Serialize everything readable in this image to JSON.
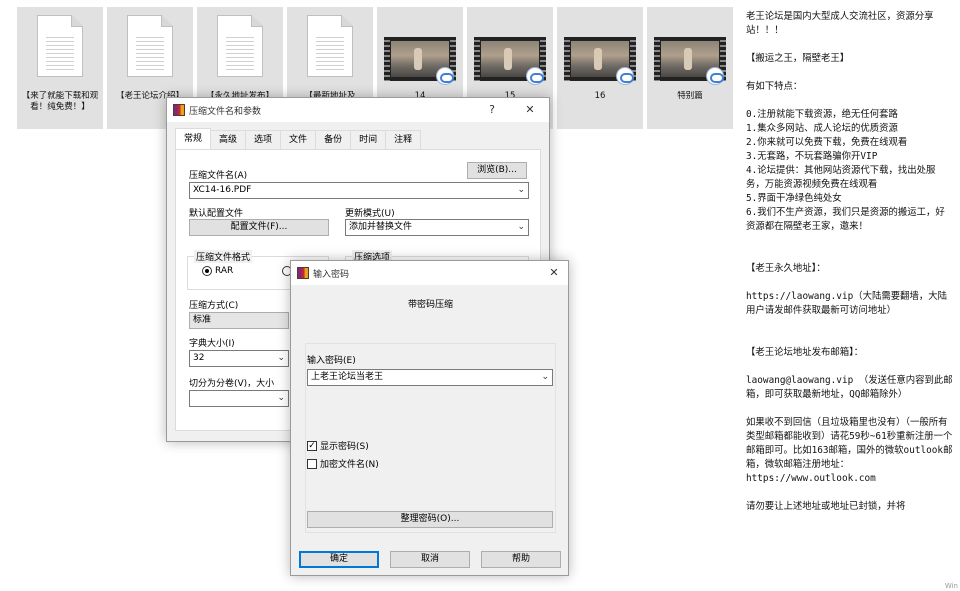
{
  "files": [
    {
      "name": "【来了就能下载和观看！纯免费！】",
      "kind": "document"
    },
    {
      "name": "【老王论坛介绍】",
      "kind": "document"
    },
    {
      "name": "【永久地址发布】",
      "kind": "document"
    },
    {
      "name": "【最新地址及",
      "kind": "document"
    },
    {
      "name": "14",
      "kind": "video"
    },
    {
      "name": "15",
      "kind": "video"
    },
    {
      "name": "16",
      "kind": "video"
    },
    {
      "name": "特别篇",
      "kind": "video"
    }
  ],
  "text_pane": {
    "lines": [
      "老王论坛是国内大型成人交流社区，资源分享站！！！",
      "",
      "【搬运之王，隔壁老王】",
      "",
      "有如下特点：",
      "",
      "0.注册就能下载资源，绝无任何套路\n1.集众多网站、成人论坛的优质资源\n2.你来就可以免费下载，免费在线观看\n3.无套路，不玩套路骗你开VIP\n4.论坛提供：其他网站资源代下载，找出处服务，万能资源视频免费在线观看\n5.界面干净绿色纯处女\n6.我们不生产资源，我们只是资源的搬运工，好资源都在隔壁老王家，邀来！",
      "",
      "",
      "【老王永久地址】：",
      "",
      "https://laowang.vip（大陆需要翻墙，大陆用户请发邮件获取最新可访问地址）",
      "",
      "",
      "【老王论坛地址发布邮箱】：",
      "",
      "laowang@laowang.vip （发送任意内容到此邮箱，即可获取最新地址，QQ邮箱除外）",
      "",
      "如果收不到回信（且垃圾箱里也没有）（一般所有类型邮箱都能收到）请花59秒~61秒重新注册一个邮箱即可。比如163邮箱，国外的微软outlook邮箱，微软邮箱注册地址：\nhttps://www.outlook.com",
      "",
      "请勿要让上述地址或地址已封锁，并将"
    ],
    "corner": "Win"
  },
  "archive_dialog": {
    "title": "压缩文件名和参数",
    "help_glyph": "?",
    "close_glyph": "✕",
    "tabs": [
      "常规",
      "高级",
      "选项",
      "文件",
      "备份",
      "时间",
      "注释"
    ],
    "active_tab": 0,
    "archive_name_label": "压缩文件名(A)",
    "archive_name_value": "XC14-16.PDF",
    "browse_button": "浏览(B)...",
    "default_profile_label": "默认配置文件",
    "profiles_button": "配置文件(F)...",
    "update_mode_label": "更新模式(U)",
    "update_mode_value": "添加并替换文件",
    "format_group_title": "压缩文件格式",
    "format_rar_label": "RAR",
    "options_group_title": "压缩选项",
    "method_label": "压缩方式(C)",
    "method_value": "标准",
    "dict_label": "字典大小(I)",
    "dict_value": "32",
    "split_label": "切分为分卷(V)，大小"
  },
  "password_dialog": {
    "title": "输入密码",
    "close_glyph": "✕",
    "heading": "带密码压缩",
    "password_label": "输入密码(E)",
    "password_value": "上老王论坛当老王",
    "show_password_label": "显示密码(S)",
    "show_password_checked": true,
    "encrypt_names_label": "加密文件名(N)",
    "encrypt_names_checked": false,
    "organize_button": "整理密码(O)...",
    "ok_button": "确定",
    "cancel_button": "取消",
    "help_button": "帮助"
  }
}
